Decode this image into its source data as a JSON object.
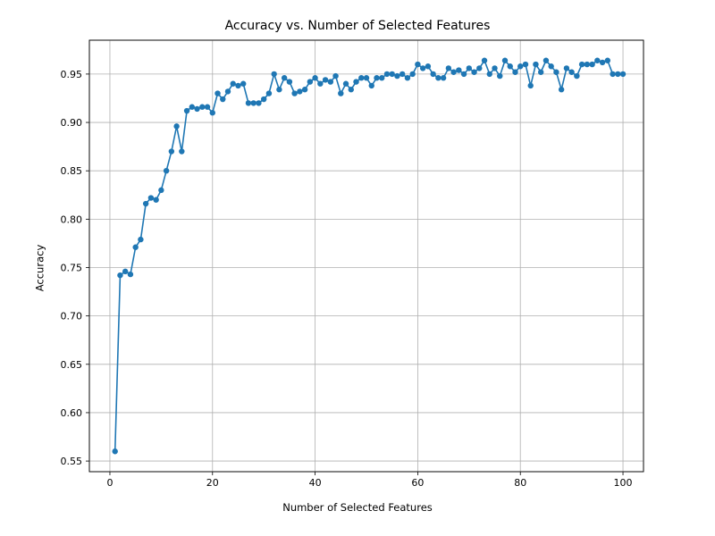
{
  "chart_data": {
    "type": "line",
    "title": "Accuracy vs. Number of Selected Features",
    "xlabel": "Number of Selected Features",
    "ylabel": "Accuracy",
    "xlim": [
      -4,
      104
    ],
    "ylim": [
      0.539,
      0.985
    ],
    "x_ticks": [
      0,
      20,
      40,
      60,
      80,
      100
    ],
    "y_ticks": [
      0.55,
      0.6,
      0.65,
      0.7,
      0.75,
      0.8,
      0.85,
      0.9,
      0.95
    ],
    "series": [
      {
        "name": "accuracy",
        "x": [
          1,
          2,
          3,
          4,
          5,
          6,
          7,
          8,
          9,
          10,
          11,
          12,
          13,
          14,
          15,
          16,
          17,
          18,
          19,
          20,
          21,
          22,
          23,
          24,
          25,
          26,
          27,
          28,
          29,
          30,
          31,
          32,
          33,
          34,
          35,
          36,
          37,
          38,
          39,
          40,
          41,
          42,
          43,
          44,
          45,
          46,
          47,
          48,
          49,
          50,
          51,
          52,
          53,
          54,
          55,
          56,
          57,
          58,
          59,
          60,
          61,
          62,
          63,
          64,
          65,
          66,
          67,
          68,
          69,
          70,
          71,
          72,
          73,
          74,
          75,
          76,
          77,
          78,
          79,
          80,
          81,
          82,
          83,
          84,
          85,
          86,
          87,
          88,
          89,
          90,
          91,
          92,
          93,
          94,
          95,
          96,
          97,
          98,
          99,
          100
        ],
        "y": [
          0.56,
          0.742,
          0.746,
          0.743,
          0.771,
          0.779,
          0.816,
          0.822,
          0.82,
          0.83,
          0.85,
          0.87,
          0.896,
          0.87,
          0.912,
          0.916,
          0.914,
          0.916,
          0.916,
          0.91,
          0.93,
          0.924,
          0.932,
          0.94,
          0.938,
          0.94,
          0.92,
          0.92,
          0.92,
          0.924,
          0.93,
          0.95,
          0.934,
          0.946,
          0.942,
          0.93,
          0.932,
          0.934,
          0.942,
          0.946,
          0.94,
          0.944,
          0.942,
          0.948,
          0.93,
          0.94,
          0.934,
          0.942,
          0.946,
          0.946,
          0.938,
          0.946,
          0.946,
          0.95,
          0.95,
          0.948,
          0.95,
          0.946,
          0.95,
          0.96,
          0.956,
          0.958,
          0.95,
          0.946,
          0.946,
          0.956,
          0.952,
          0.954,
          0.95,
          0.956,
          0.952,
          0.956,
          0.964,
          0.95,
          0.956,
          0.948,
          0.964,
          0.958,
          0.952,
          0.958,
          0.96,
          0.938,
          0.96,
          0.952,
          0.964,
          0.958,
          0.952,
          0.934,
          0.956,
          0.952,
          0.948,
          0.96,
          0.96,
          0.96,
          0.964,
          0.962,
          0.964,
          0.95,
          0.95,
          0.95
        ]
      }
    ],
    "color": "#1f77b4",
    "grid": true,
    "markers": true
  }
}
